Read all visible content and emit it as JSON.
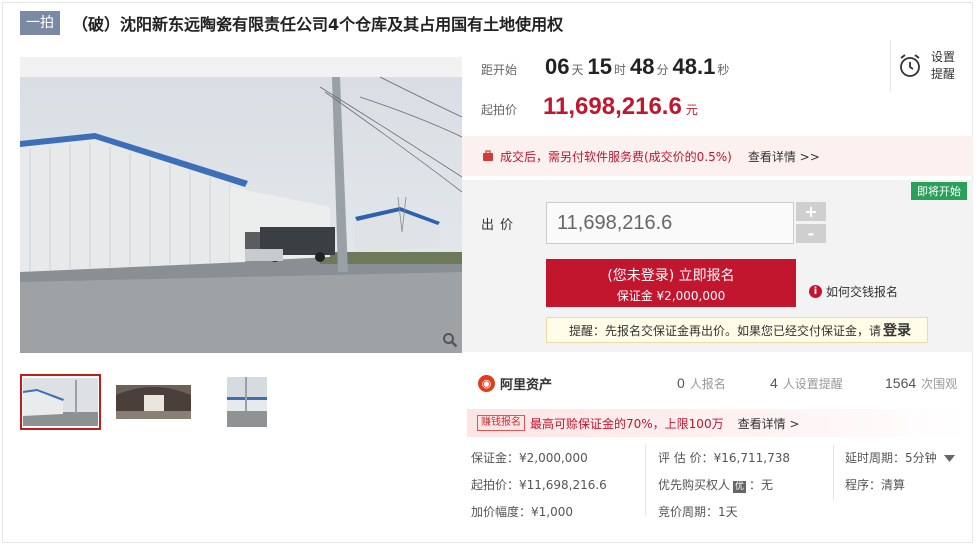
{
  "header": {
    "tag": "一拍",
    "title": "（破）沈阳新东远陶瓷有限责任公司4个仓库及其占用国有土地使用权"
  },
  "countdown": {
    "label": "距开始",
    "days": "06",
    "days_unit": "天",
    "hours": "15",
    "hours_unit": "时",
    "minutes": "48",
    "minutes_unit": "分",
    "seconds": "48.1",
    "seconds_unit": "秒"
  },
  "remind": {
    "line1": "设置",
    "line2": "提醒"
  },
  "start_price": {
    "label": "起拍价",
    "value": "11,698,216.6",
    "unit": "元"
  },
  "fee_notice": {
    "text": "成交后，需另付软件服务费(成交价的0.5%)",
    "link": "查看详情 >>"
  },
  "bid": {
    "status_badge": "即将开始",
    "label": "出价",
    "value": "11,698,216.6",
    "plus": "+",
    "minus": "-",
    "signup_main": "(您未登录) 立即报名",
    "signup_sub": "保证金 ¥2,000,000",
    "howto": "如何交钱报名",
    "tip_text": "提醒：先报名交保证金再出价。如果您已经交付保证金，请",
    "tip_link": "登录"
  },
  "stats": {
    "brand": "阿里资产",
    "signups_num": "0",
    "signups_label": "人报名",
    "reminders_num": "4",
    "reminders_label": "人设置提醒",
    "views_num": "1564",
    "views_label": "次围观"
  },
  "promo": {
    "tag": "赚钱报名",
    "text": "最高可赊保证金的70%，上限100万",
    "link": "查看详情 >"
  },
  "info": {
    "deposit": "保证金：¥2,000,000",
    "start": "起拍价：¥11,698,216.6",
    "increment": "加价幅度：¥1,000",
    "appraisal": "评 估 价：¥16,711,738",
    "priority_label": "优先购买权人",
    "priority_badge": "优",
    "priority_value": "：无",
    "cycle": "竞价周期：1天",
    "delay": "延时周期：5分钟",
    "procedure": "程序：清算"
  },
  "colors": {
    "accent": "#c2152e",
    "tag_bg": "#7a8aa5",
    "badge_green": "#2aa15a"
  }
}
